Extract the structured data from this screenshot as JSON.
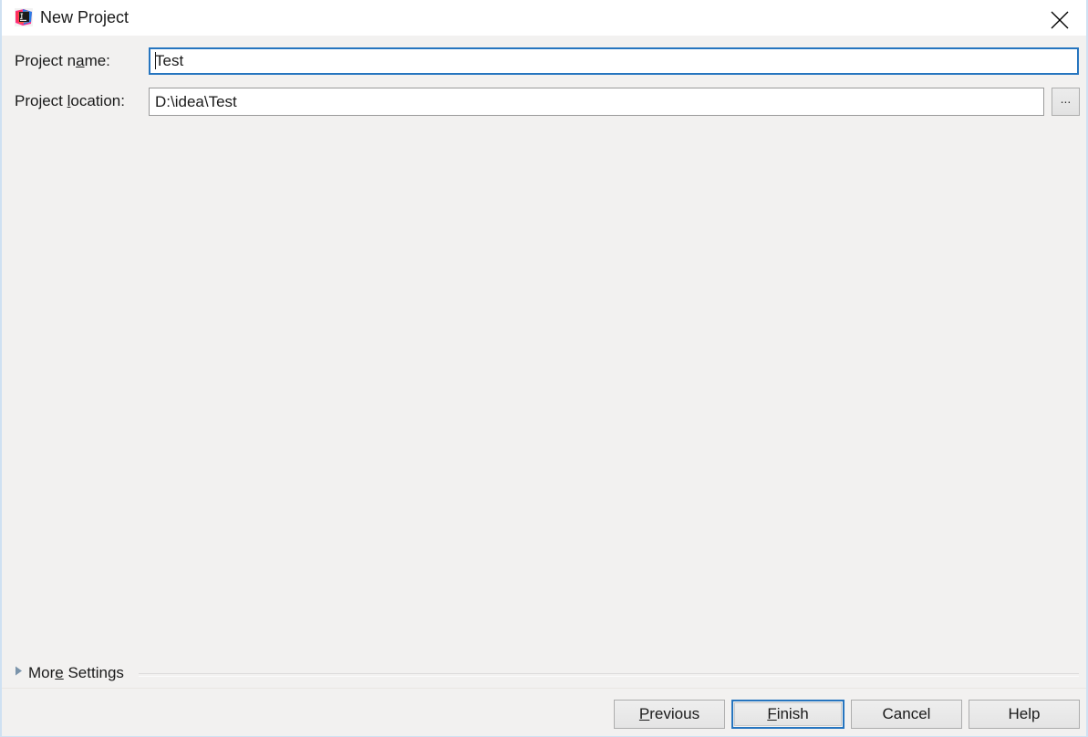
{
  "window": {
    "title": "New Project",
    "app_icon_name": "intellij-idea-icon",
    "close_icon_name": "close-icon",
    "background_color": "#f2f1f0",
    "titlebar_color": "#ffffff",
    "accent_color": "#2675bf",
    "border_color": "#cfe1f2"
  },
  "form": {
    "project_name": {
      "label_prefix": "Project n",
      "label_mnemonic": "a",
      "label_suffix": "me:",
      "value": "Test",
      "focused": true
    },
    "project_location": {
      "label_prefix": "Project ",
      "label_mnemonic": "l",
      "label_suffix": "ocation:",
      "value": "D:\\idea\\Test",
      "focused": false
    },
    "browse_button_label": "..."
  },
  "more_settings": {
    "label_prefix": "Mor",
    "label_mnemonic": "e",
    "label_suffix": " Settings",
    "expanded": false,
    "triangle_icon_name": "disclosure-triangle-right-icon"
  },
  "footer": {
    "buttons": [
      {
        "prefix": "",
        "mnemonic": "P",
        "suffix": "revious",
        "default": false
      },
      {
        "prefix": "",
        "mnemonic": "F",
        "suffix": "inish",
        "default": true
      },
      {
        "prefix": "Cancel",
        "mnemonic": "",
        "suffix": "",
        "default": false
      },
      {
        "prefix": "Help",
        "mnemonic": "",
        "suffix": "",
        "default": false
      }
    ]
  }
}
